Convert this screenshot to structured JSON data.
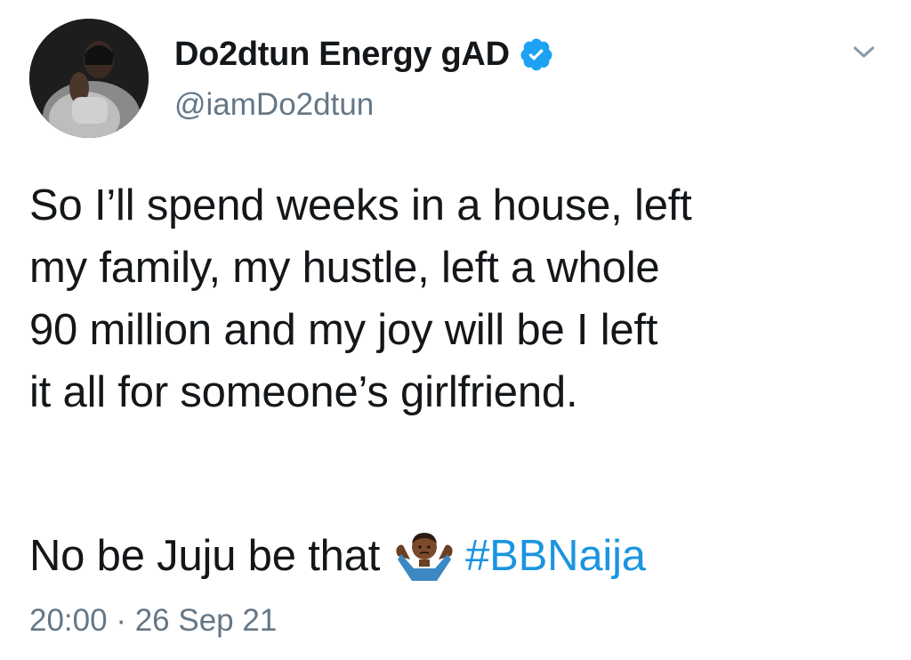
{
  "author": {
    "display_name": "Do2dtun Energy gAD",
    "handle": "@iamDo2dtun",
    "verified": true
  },
  "tweet": {
    "text": "So I’ll spend weeks in a house, left\nmy family, my hustle, left a whole\n90 million and my joy will be I left\nit all for someone’s girlfriend.",
    "second_line": "No be Juju be that",
    "emoji": "man-shrugging-emoji",
    "hashtag": "#BBNaija",
    "time": "20:00",
    "separator": "·",
    "date": "26 Sep 21"
  },
  "icons": {
    "verified": "verified-badge-icon",
    "menu": "chevron-down-icon"
  },
  "colors": {
    "link": "#1b95e0",
    "secondary_text": "#657786",
    "primary_text": "#14171a",
    "verified_badge": "#1da1f2"
  }
}
